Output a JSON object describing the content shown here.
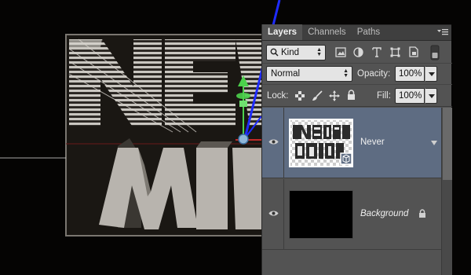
{
  "panel": {
    "tabs": [
      {
        "label": "Layers",
        "active": true
      },
      {
        "label": "Channels",
        "active": false
      },
      {
        "label": "Paths",
        "active": false
      }
    ],
    "filter": {
      "label": "Kind"
    },
    "blend_mode": "Normal",
    "opacity_label": "Opacity:",
    "opacity_value": "100%",
    "lock_label": "Lock:",
    "fill_label": "Fill:",
    "fill_value": "100%",
    "layers": [
      {
        "name": "Never",
        "selected": true
      },
      {
        "name": "Background",
        "locked": true
      }
    ]
  },
  "canvas": {
    "artwork_text": [
      "NEVER",
      "MIND"
    ]
  },
  "colors": {
    "panel_bg": "#535353",
    "selected_layer": "#5e6c82",
    "tab_bar": "#3f3f3f",
    "gizmo_green": "#4cd14c",
    "gizmo_blue": "#1e2bff",
    "gizmo_red": "#c42a2a"
  }
}
